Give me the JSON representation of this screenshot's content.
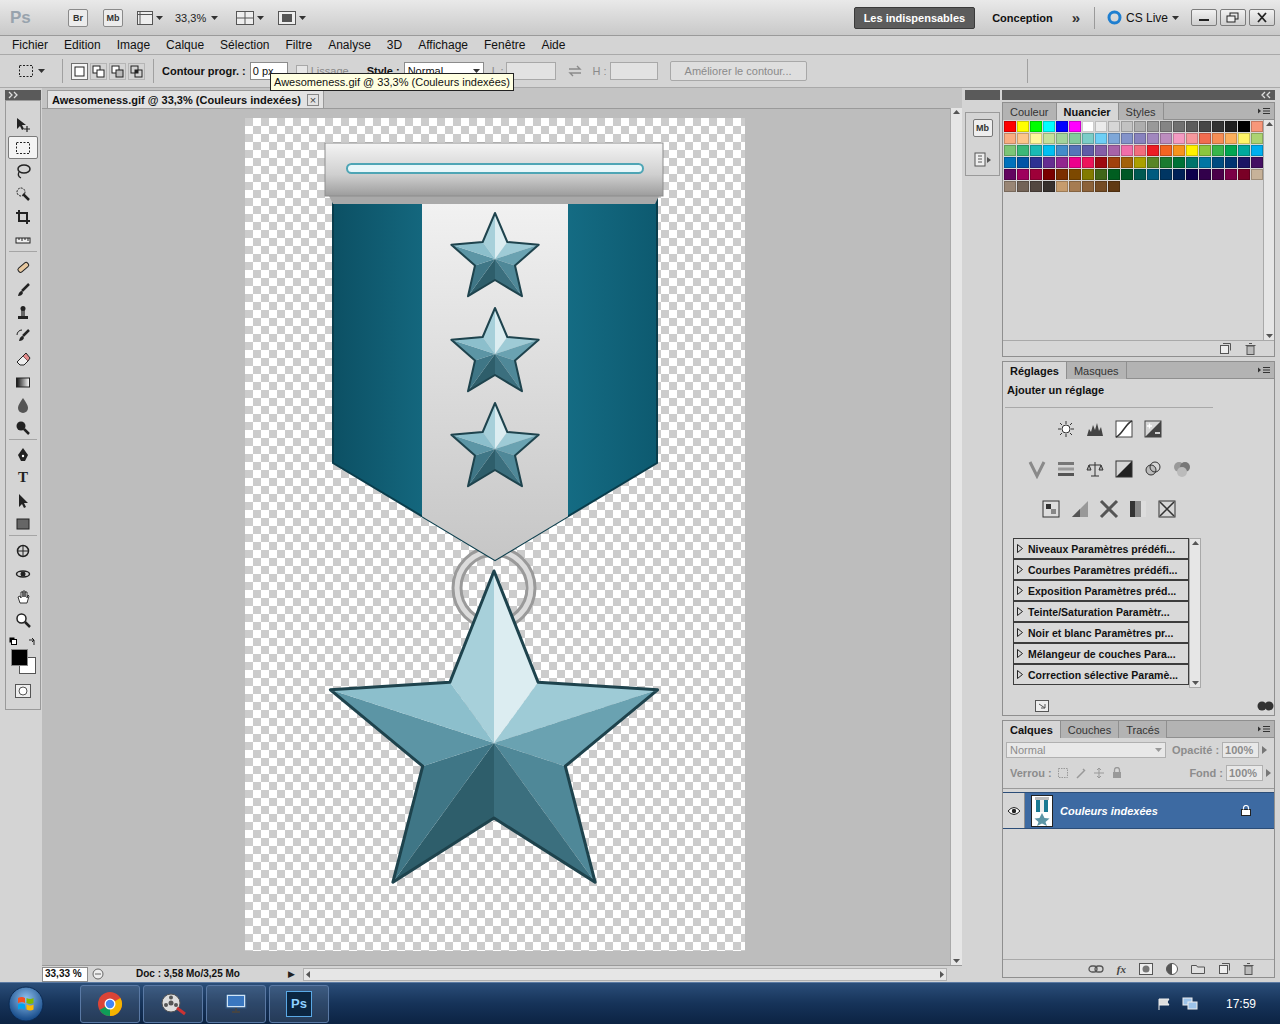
{
  "app": {
    "logo": "Ps",
    "bridge": "Br",
    "mini_bridge": "Mb",
    "zoom": "33,3%",
    "workspaces": [
      {
        "label": "Les indispensables",
        "selected": true
      },
      {
        "label": "Conception",
        "selected": false
      }
    ],
    "more": "»",
    "cs_live": "CS Live"
  },
  "menu": [
    "Fichier",
    "Edition",
    "Image",
    "Calque",
    "Sélection",
    "Filtre",
    "Analyse",
    "3D",
    "Affichage",
    "Fenêtre",
    "Aide"
  ],
  "options": {
    "modes": [
      {
        "selected": true
      },
      {
        "selected": false
      },
      {
        "selected": false
      },
      {
        "selected": false
      }
    ],
    "feather_label": "Contour progr. :",
    "feather_value": "0 px",
    "antialias": {
      "label": "Lissage",
      "disabled": true,
      "checked": false
    },
    "style_label": "Style :",
    "style_value": "Normal",
    "width": {
      "label": "L :",
      "disabled": true
    },
    "height": {
      "label": "H :",
      "disabled": true
    },
    "refine": {
      "label": "Améliorer le contour...",
      "disabled": true
    }
  },
  "tooltip": "Awesomeness.gif @ 33,3% (Couleurs indexées)",
  "document": {
    "tab": "Awesomeness.gif @ 33,3% (Couleurs indexées)",
    "close": "×",
    "zoom": "33,33 %",
    "info": "Doc : 3,58 Mo/3,25 Mo",
    "info_menu": "▶"
  },
  "tools": [
    {
      "kind": "move",
      "selected": false
    },
    {
      "kind": "marquee",
      "selected": true
    },
    {
      "kind": "lasso",
      "selected": false
    },
    {
      "kind": "quick",
      "selected": false
    },
    {
      "kind": "crop",
      "selected": false
    },
    {
      "kind": "ruler",
      "selected": false
    },
    {
      "kind": "heal",
      "selected": false
    },
    {
      "kind": "brush",
      "selected": false
    },
    {
      "kind": "stamp",
      "selected": false
    },
    {
      "kind": "history",
      "selected": false
    },
    {
      "kind": "eraser",
      "selected": false
    },
    {
      "kind": "gradient",
      "selected": false
    },
    {
      "kind": "blur",
      "selected": false
    },
    {
      "kind": "dodge",
      "selected": false
    },
    {
      "kind": "pen",
      "selected": false
    },
    {
      "kind": "type",
      "label": "T",
      "selected": false
    },
    {
      "kind": "path",
      "selected": false
    },
    {
      "kind": "shape",
      "selected": false
    },
    {
      "kind": "rotate",
      "selected": false
    },
    {
      "kind": "orbit",
      "selected": false
    },
    {
      "kind": "hand",
      "selected": false
    },
    {
      "kind": "zoom",
      "selected": false
    }
  ],
  "strip": {
    "mini_bridge": "Mb"
  },
  "swatches_panel": {
    "tabs": [
      {
        "label": "Couleur",
        "selected": false
      },
      {
        "label": "Nuancier",
        "selected": true
      },
      {
        "label": "Styles",
        "selected": false
      }
    ],
    "swatches": [
      {
        "color": "#ff0000"
      },
      {
        "color": "#ffff00"
      },
      {
        "color": "#00ff00"
      },
      {
        "color": "#00ffff"
      },
      {
        "color": "#0000ff"
      },
      {
        "color": "#ff00ff"
      },
      {
        "color": "#ffffff"
      },
      {
        "color": "#ebebeb"
      },
      {
        "color": "#d6d6d6"
      },
      {
        "color": "#c2c2c2"
      },
      {
        "color": "#adadad"
      },
      {
        "color": "#999999"
      },
      {
        "color": "#858585"
      },
      {
        "color": "#707070"
      },
      {
        "color": "#5c5c5c"
      },
      {
        "color": "#474747"
      },
      {
        "color": "#333333"
      },
      {
        "color": "#1f1f1f"
      },
      {
        "color": "#000000"
      },
      {
        "color": "#f7977a"
      },
      {
        "color": "#f9ad81"
      },
      {
        "color": "#fdc68a"
      },
      {
        "color": "#fff79a"
      },
      {
        "color": "#c4df9b"
      },
      {
        "color": "#a2d39c"
      },
      {
        "color": "#82ca9d"
      },
      {
        "color": "#7bcdc8"
      },
      {
        "color": "#6ecff6"
      },
      {
        "color": "#7ea7d8"
      },
      {
        "color": "#8493ca"
      },
      {
        "color": "#8882be"
      },
      {
        "color": "#a187be"
      },
      {
        "color": "#bc8dbf"
      },
      {
        "color": "#f49ac2"
      },
      {
        "color": "#f6989d"
      },
      {
        "color": "#f26c4f"
      },
      {
        "color": "#f68e55"
      },
      {
        "color": "#fbaf5c"
      },
      {
        "color": "#fff467"
      },
      {
        "color": "#acd372"
      },
      {
        "color": "#7cc576"
      },
      {
        "color": "#3bb878"
      },
      {
        "color": "#1abbb4"
      },
      {
        "color": "#00bff3"
      },
      {
        "color": "#438cca"
      },
      {
        "color": "#5574b9"
      },
      {
        "color": "#605ca8"
      },
      {
        "color": "#855fa8"
      },
      {
        "color": "#a763a8"
      },
      {
        "color": "#f06ea9"
      },
      {
        "color": "#f26d7d"
      },
      {
        "color": "#ed1c24"
      },
      {
        "color": "#f26522"
      },
      {
        "color": "#f7941d"
      },
      {
        "color": "#fff200"
      },
      {
        "color": "#8dc73f"
      },
      {
        "color": "#39b54a"
      },
      {
        "color": "#00a651"
      },
      {
        "color": "#00a99d"
      },
      {
        "color": "#00aeef"
      },
      {
        "color": "#0072bc"
      },
      {
        "color": "#0054a6"
      },
      {
        "color": "#2e3192"
      },
      {
        "color": "#662d91"
      },
      {
        "color": "#92278f"
      },
      {
        "color": "#ec008c"
      },
      {
        "color": "#ed145b"
      },
      {
        "color": "#9e0b0f"
      },
      {
        "color": "#a0410d"
      },
      {
        "color": "#a36209"
      },
      {
        "color": "#aba000"
      },
      {
        "color": "#598527"
      },
      {
        "color": "#1a7b30"
      },
      {
        "color": "#007236"
      },
      {
        "color": "#00746b"
      },
      {
        "color": "#0076a3"
      },
      {
        "color": "#004b80"
      },
      {
        "color": "#003471"
      },
      {
        "color": "#1b1464"
      },
      {
        "color": "#440e62"
      },
      {
        "color": "#630460"
      },
      {
        "color": "#9e005d"
      },
      {
        "color": "#9e0039"
      },
      {
        "color": "#790000"
      },
      {
        "color": "#7b2e00"
      },
      {
        "color": "#7d4900"
      },
      {
        "color": "#827b00"
      },
      {
        "color": "#406618"
      },
      {
        "color": "#005e20"
      },
      {
        "color": "#005826"
      },
      {
        "color": "#005952"
      },
      {
        "color": "#005b7f"
      },
      {
        "color": "#003663"
      },
      {
        "color": "#002157"
      },
      {
        "color": "#0d004c"
      },
      {
        "color": "#32004b"
      },
      {
        "color": "#4b0049"
      },
      {
        "color": "#7b0046"
      },
      {
        "color": "#7a0026"
      },
      {
        "color": "#c7b299"
      },
      {
        "color": "#998675"
      },
      {
        "color": "#736357"
      },
      {
        "color": "#534741"
      },
      {
        "color": "#37302d"
      },
      {
        "color": "#c69c6d"
      },
      {
        "color": "#a67c52"
      },
      {
        "color": "#8c6239"
      },
      {
        "color": "#754c24"
      },
      {
        "color": "#603913"
      }
    ]
  },
  "adjustments_panel": {
    "tabs": [
      {
        "label": "Réglages",
        "selected": true
      },
      {
        "label": "Masques",
        "selected": false
      }
    ],
    "title": "Ajouter un réglage",
    "presets": [
      "Niveaux Paramètres prédéfi...",
      "Courbes Paramètres prédéfi...",
      "Exposition Paramètres préd...",
      "Teinte/Saturation Paramètr...",
      "Noir et blanc Paramètres pr...",
      "Mélangeur de couches Para...",
      "Correction sélective Paramè..."
    ]
  },
  "layers_panel": {
    "tabs": [
      {
        "label": "Calques",
        "selected": true
      },
      {
        "label": "Couches",
        "selected": false
      },
      {
        "label": "Tracés",
        "selected": false
      }
    ],
    "blend_mode": {
      "value": "Normal",
      "disabled": true
    },
    "opacity": {
      "label": "Opacité :",
      "value": "100%",
      "disabled": true
    },
    "lock": {
      "label": "Verrou :",
      "disabled": true
    },
    "fill": {
      "label": "Fond :",
      "value": "100%",
      "disabled": true
    },
    "layers": [
      {
        "name": "Couleurs indexées",
        "visible": true,
        "selected": true,
        "locked": true
      }
    ],
    "fx_icon": "fx"
  },
  "taskbar": {
    "apps": [
      {
        "kind": "chrome",
        "selected": false
      },
      {
        "kind": "media",
        "selected": false
      },
      {
        "kind": "remote",
        "selected": false
      },
      {
        "kind": "photoshop",
        "label": "Ps",
        "selected": false
      }
    ],
    "time": "17:59"
  }
}
